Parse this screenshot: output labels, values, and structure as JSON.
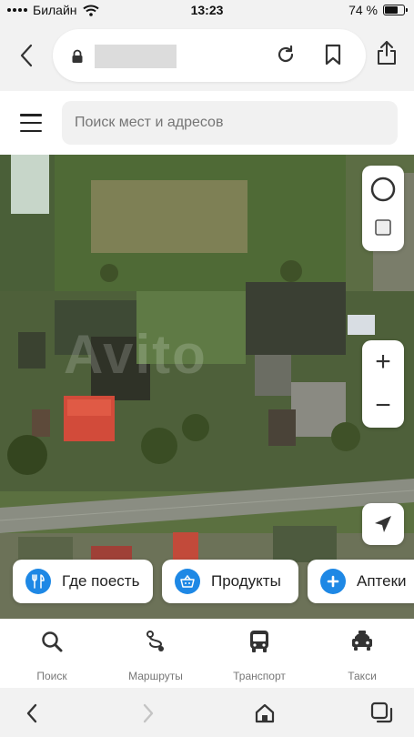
{
  "status_bar": {
    "carrier": "Билайн",
    "time": "13:23",
    "battery_text": "74 %",
    "battery_level": 0.74
  },
  "browser": {
    "back_icon": "chevron-left-icon",
    "lock_icon": "lock-icon",
    "reload_icon": "reload-icon",
    "bookmark_icon": "bookmark-icon",
    "share_icon": "share-icon"
  },
  "search": {
    "placeholder": "Поиск мест и адресов",
    "menu_icon": "hamburger-menu-icon"
  },
  "map": {
    "watermark": "Avito",
    "controls": {
      "layers_icon": "layers-circle-icon",
      "layers_square_icon": "layers-square-icon",
      "zoom_in": "+",
      "zoom_out": "−",
      "locate_icon": "location-arrow-icon"
    },
    "chips": [
      {
        "label": "Где поесть",
        "icon": "fork-knife-icon"
      },
      {
        "label": "Продукты",
        "icon": "basket-icon"
      },
      {
        "label": "Аптеки",
        "icon": "plus-cross-icon"
      }
    ]
  },
  "tabs": [
    {
      "label": "Поиск",
      "icon": "search-icon"
    },
    {
      "label": "Маршруты",
      "icon": "route-icon"
    },
    {
      "label": "Транспорт",
      "icon": "bus-icon"
    },
    {
      "label": "Такси",
      "icon": "taxi-icon"
    }
  ],
  "colors": {
    "accent": "#1e88e5",
    "background": "#f2f2f2",
    "roof_red": "#d24b3a"
  }
}
